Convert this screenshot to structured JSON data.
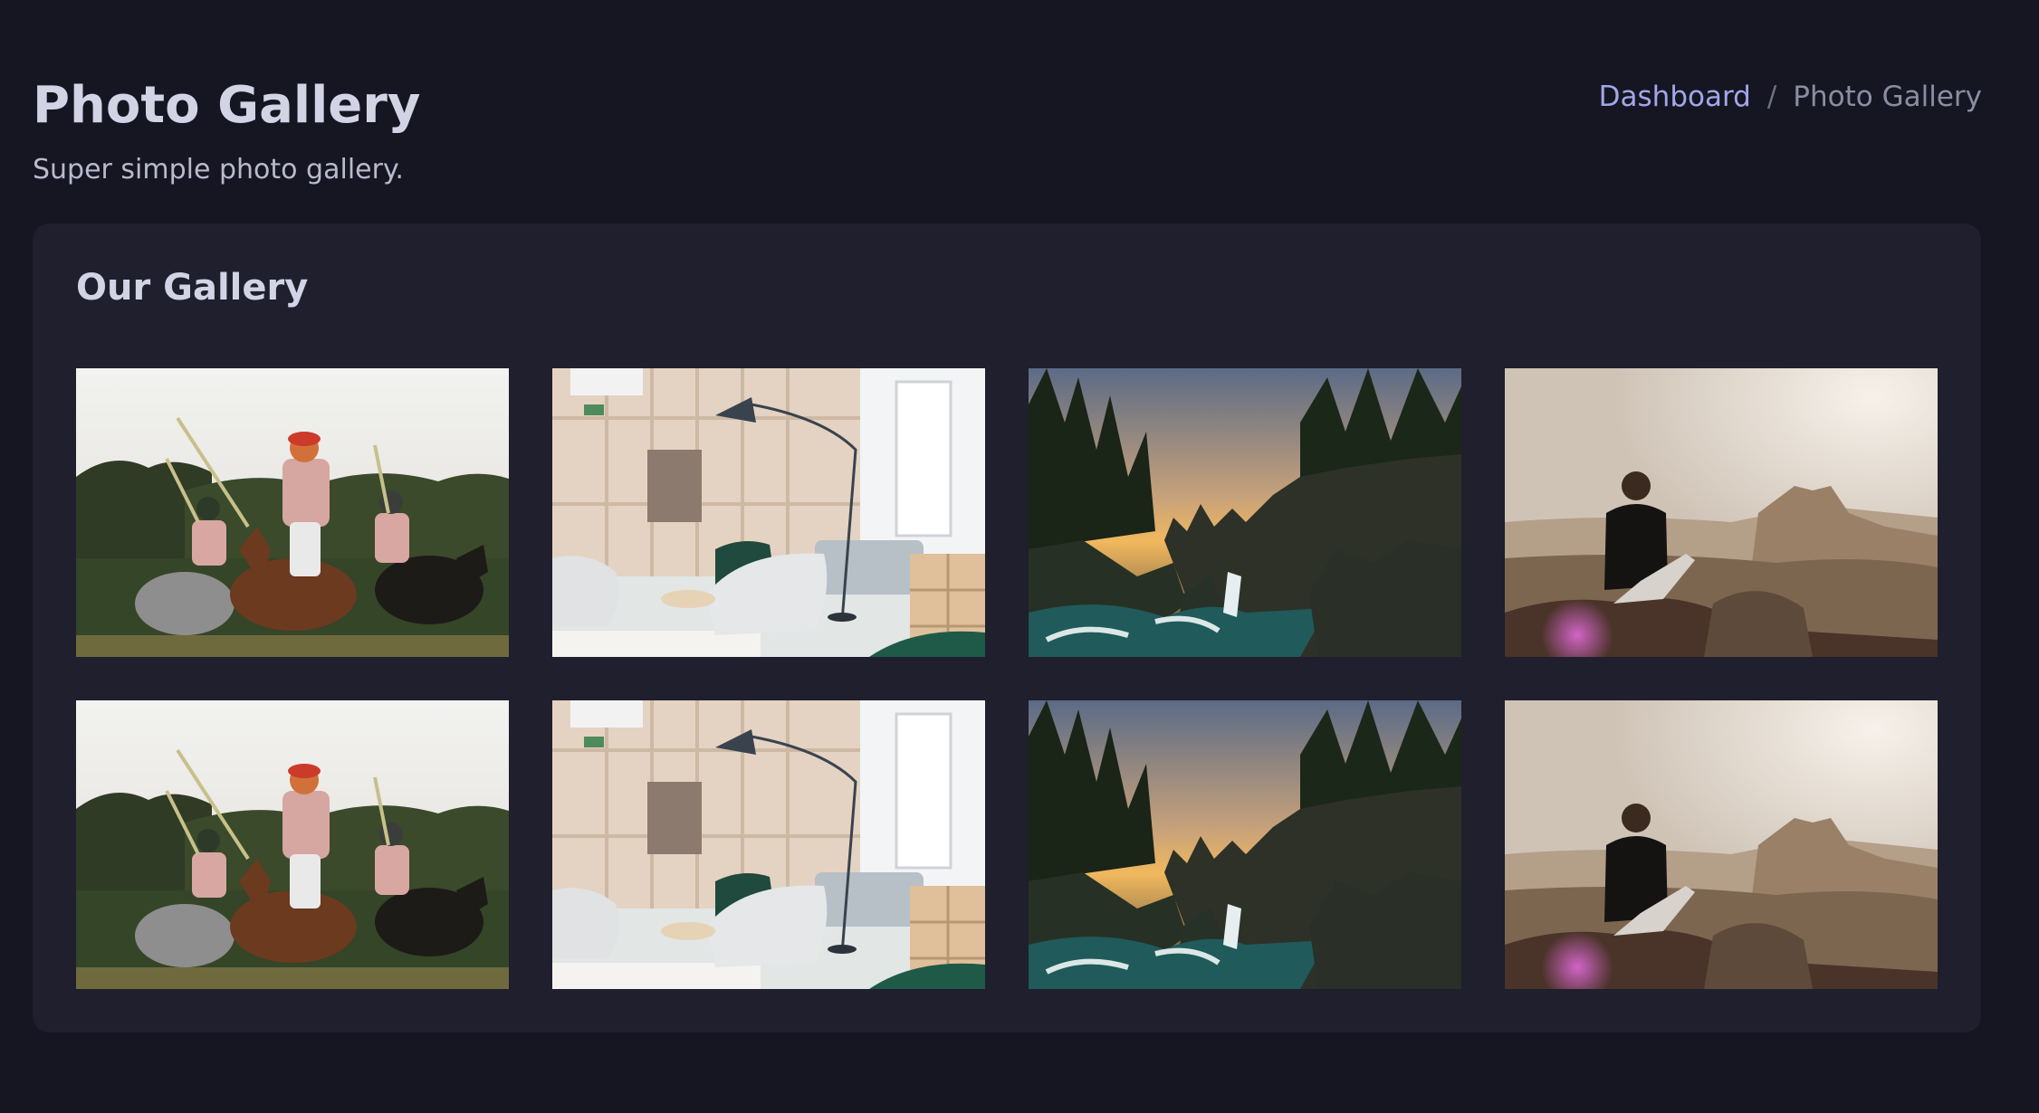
{
  "header": {
    "title": "Photo Gallery",
    "subtitle": "Super simple photo gallery."
  },
  "breadcrumb": {
    "items": [
      {
        "label": "Dashboard"
      },
      {
        "label": "/"
      },
      {
        "label": "Photo Gallery"
      }
    ]
  },
  "gallery": {
    "title": "Our Gallery",
    "photos": [
      {
        "subject": "polo-riders"
      },
      {
        "subject": "interior-lounge"
      },
      {
        "subject": "coastal-cliffs-sunset"
      },
      {
        "subject": "person-on-mountain-rock"
      },
      {
        "subject": "polo-riders"
      },
      {
        "subject": "interior-lounge"
      },
      {
        "subject": "coastal-cliffs-sunset"
      },
      {
        "subject": "person-on-mountain-rock"
      }
    ]
  },
  "colors": {
    "background": "#161622",
    "card": "#1f1f2d",
    "link": "#a2a6ea",
    "muted": "#8b8da3"
  }
}
